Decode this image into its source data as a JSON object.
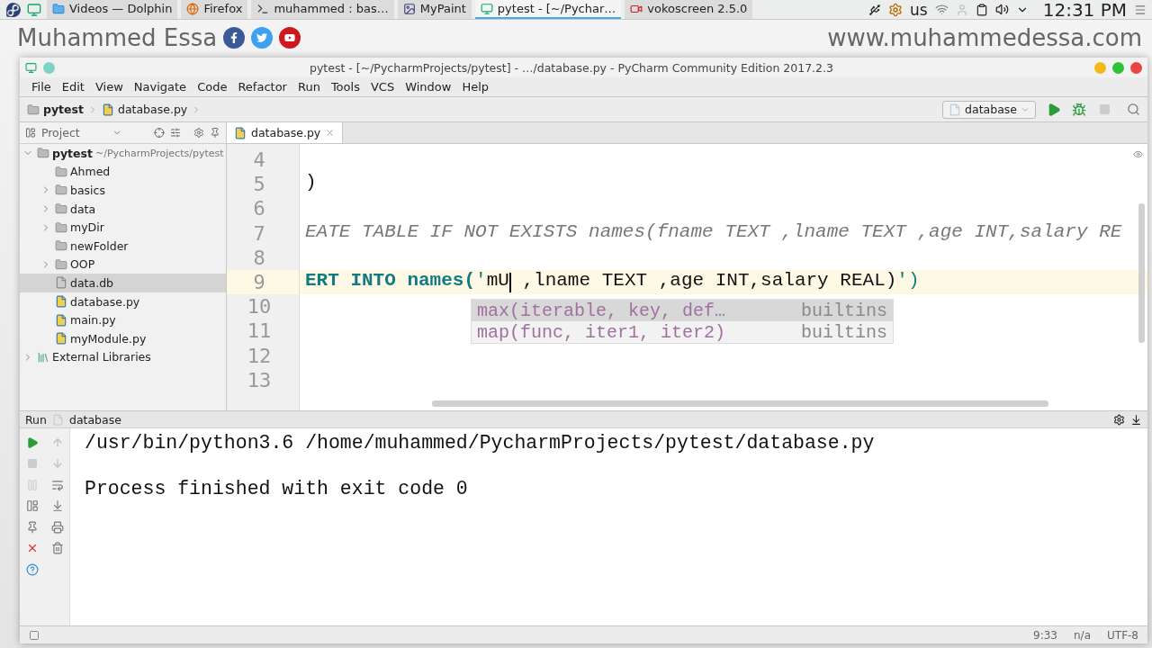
{
  "taskbar": {
    "tasks": [
      {
        "label": "Videos — Dolphin",
        "kind": "folder",
        "selected": false
      },
      {
        "label": "Firefox",
        "kind": "browser",
        "selected": false
      },
      {
        "label": "muhammed : bas…",
        "kind": "terminal",
        "selected": false
      },
      {
        "label": "MyPaint",
        "kind": "paint",
        "selected": false
      },
      {
        "label": "pytest - [~/Pychar…",
        "kind": "ide",
        "selected": true
      },
      {
        "label": "vokoscreen 2.5.0",
        "kind": "recorder",
        "selected": false
      }
    ],
    "keyboard_layout": "us",
    "clock": "12:31 PM"
  },
  "banner": {
    "name": "Muhammed Essa",
    "website": "www.muhammedessa.com"
  },
  "window": {
    "title": "pytest - [~/PycharmProjects/pytest] - …/database.py - PyCharm Community Edition 2017.2.3",
    "menu": [
      "File",
      "Edit",
      "View",
      "Navigate",
      "Code",
      "Refactor",
      "Run",
      "Tools",
      "VCS",
      "Window",
      "Help"
    ],
    "breadcrumbs": [
      {
        "label": "pytest",
        "kind": "folder"
      },
      {
        "label": "database.py",
        "kind": "python"
      }
    ],
    "run_config": "database",
    "project_panel": {
      "label": "Project",
      "tree": [
        {
          "label": "pytest",
          "path": "~/PycharmProjects/pytest",
          "kind": "folder",
          "expanded": true,
          "selected": false,
          "children": [
            {
              "label": "Ahmed",
              "kind": "folder",
              "selected": false
            },
            {
              "label": "basics",
              "kind": "folder",
              "expanded": false,
              "selected": false
            },
            {
              "label": "data",
              "kind": "folder",
              "expanded": false,
              "selected": false
            },
            {
              "label": "myDir",
              "kind": "folder",
              "expanded": false,
              "selected": false
            },
            {
              "label": "newFolder",
              "kind": "folder",
              "selected": false
            },
            {
              "label": "OOP",
              "kind": "folder",
              "expanded": false,
              "selected": false
            },
            {
              "label": "data.db",
              "kind": "unknown",
              "selected": true
            },
            {
              "label": "database.py",
              "kind": "python",
              "selected": false
            },
            {
              "label": "main.py",
              "kind": "python",
              "selected": false
            },
            {
              "label": "myModule.py",
              "kind": "python",
              "selected": false
            }
          ]
        },
        {
          "label": "External Libraries",
          "kind": "library",
          "expanded": false,
          "selected": false
        }
      ]
    },
    "editor": {
      "tab": "database.py",
      "lines": [
        {
          "number": "4",
          "current": false
        },
        {
          "number": "5",
          "current": false,
          "segments": [
            {
              "kind": "text",
              "text": ")"
            }
          ]
        },
        {
          "number": "6",
          "current": false
        },
        {
          "number": "7",
          "current": false,
          "segments": [
            {
              "kind": "docstring",
              "text": "EATE TABLE IF NOT EXISTS names(fname TEXT ,lname TEXT ,age INT,salary RE"
            }
          ]
        },
        {
          "number": "8",
          "current": false
        },
        {
          "number": "9",
          "current": true,
          "segments": [
            {
              "kind": "keyword",
              "text": "ERT INTO names("
            },
            {
              "kind": "string",
              "text": "'"
            },
            {
              "kind": "text",
              "text": "mU"
            },
            {
              "kind": "caret"
            },
            {
              "kind": "text",
              "text": " ,lname TEXT ,age INT,salary REAL)"
            },
            {
              "kind": "string",
              "text": "')"
            }
          ]
        },
        {
          "number": "10",
          "current": false
        },
        {
          "number": "11",
          "current": false
        },
        {
          "number": "12",
          "current": false
        },
        {
          "number": "13",
          "current": false
        }
      ],
      "completion": [
        {
          "name": "max(iterable, key, def…",
          "source": "builtins",
          "selected": true
        },
        {
          "name": "map(func, iter1, iter2)",
          "source": "builtins",
          "selected": false
        }
      ]
    },
    "run_panel": {
      "tab": "Run",
      "config": "database",
      "output": [
        "/usr/bin/python3.6 /home/muhammed/PycharmProjects/pytest/database.py",
        "Process finished with exit code 0"
      ]
    },
    "status_bar": {
      "position": "9:33",
      "separator": "n/a",
      "encoding": "UTF-8"
    }
  }
}
